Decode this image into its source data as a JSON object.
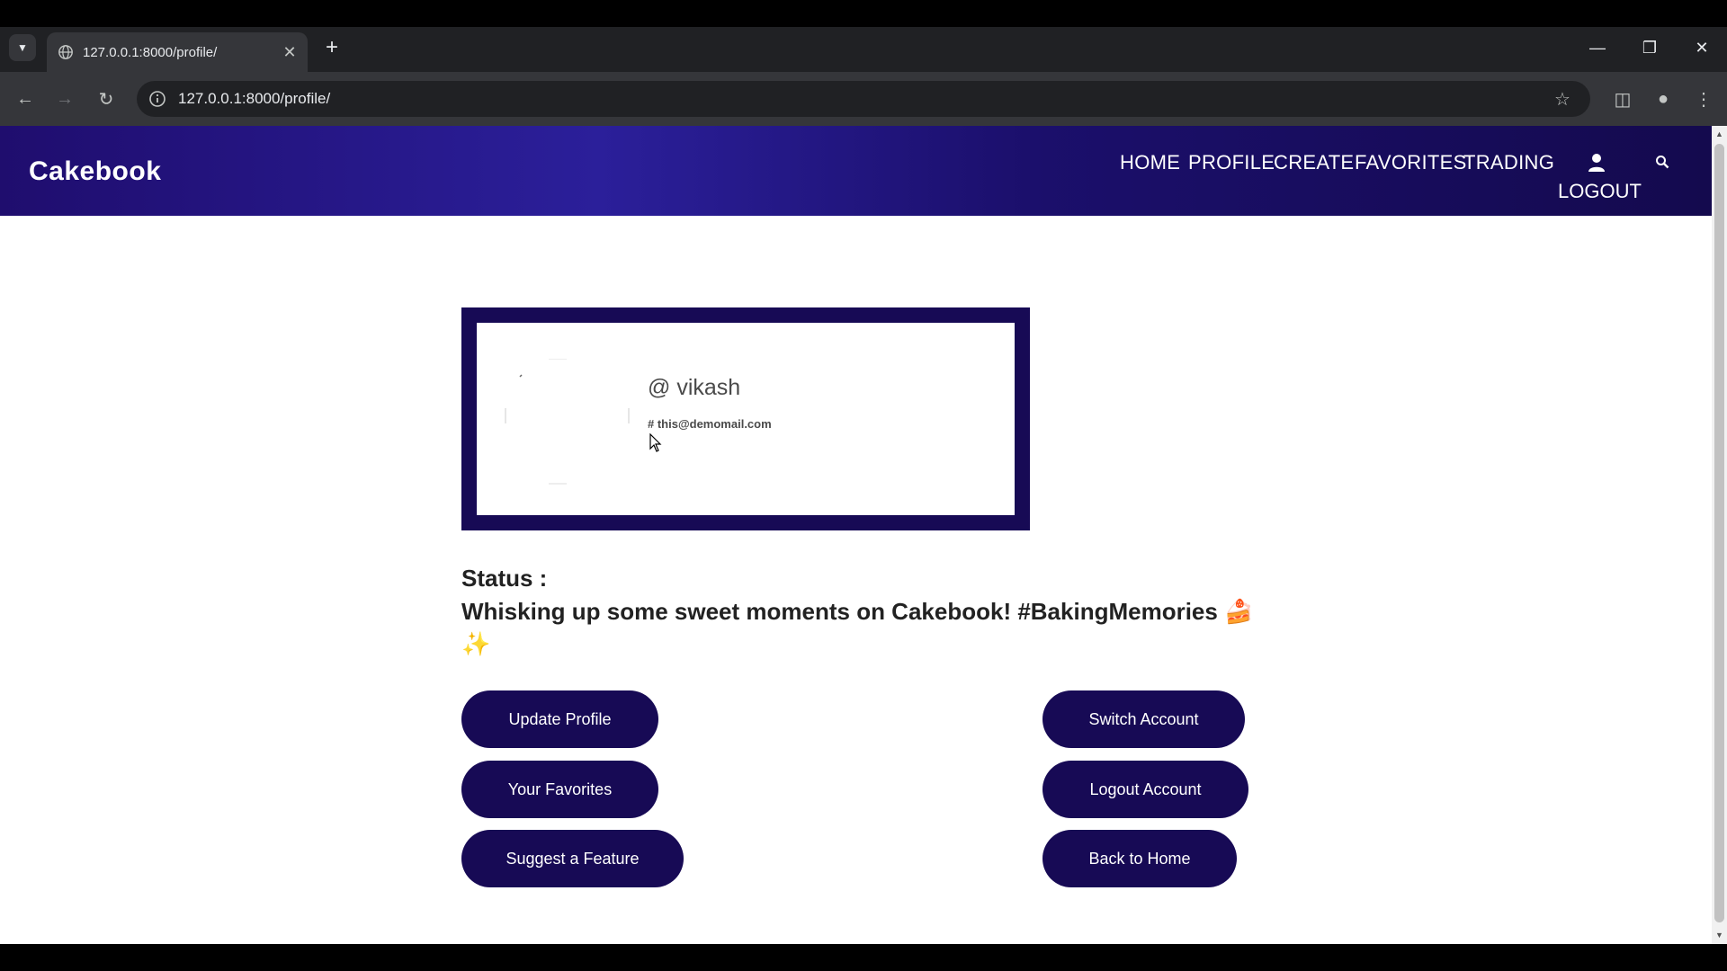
{
  "browser": {
    "tab_title": "127.0.0.1:8000/profile/",
    "url": "127.0.0.1:8000/profile/"
  },
  "site": {
    "brand": "Cakebook",
    "nav": [
      "HOME",
      "PROFILE",
      "CREATE",
      "FAVORITES",
      "TRADING"
    ],
    "logout": "LOGOUT"
  },
  "profile": {
    "username": "@ vikash",
    "email": "# this@demomail.com"
  },
  "status": {
    "label": "Status :",
    "text": "Whisking up some sweet moments on Cakebook! #BakingMemories 🍰 ✨"
  },
  "buttons": {
    "update_profile": "Update Profile",
    "your_favorites": "Your Favorites",
    "suggest_feature": "Suggest a Feature",
    "switch_account": "Switch Account",
    "logout_account": "Logout Account",
    "back_home": "Back to Home"
  },
  "colors": {
    "accent": "#170a55",
    "nav_start": "#1f0d6e",
    "nav_end": "#140a4e"
  }
}
